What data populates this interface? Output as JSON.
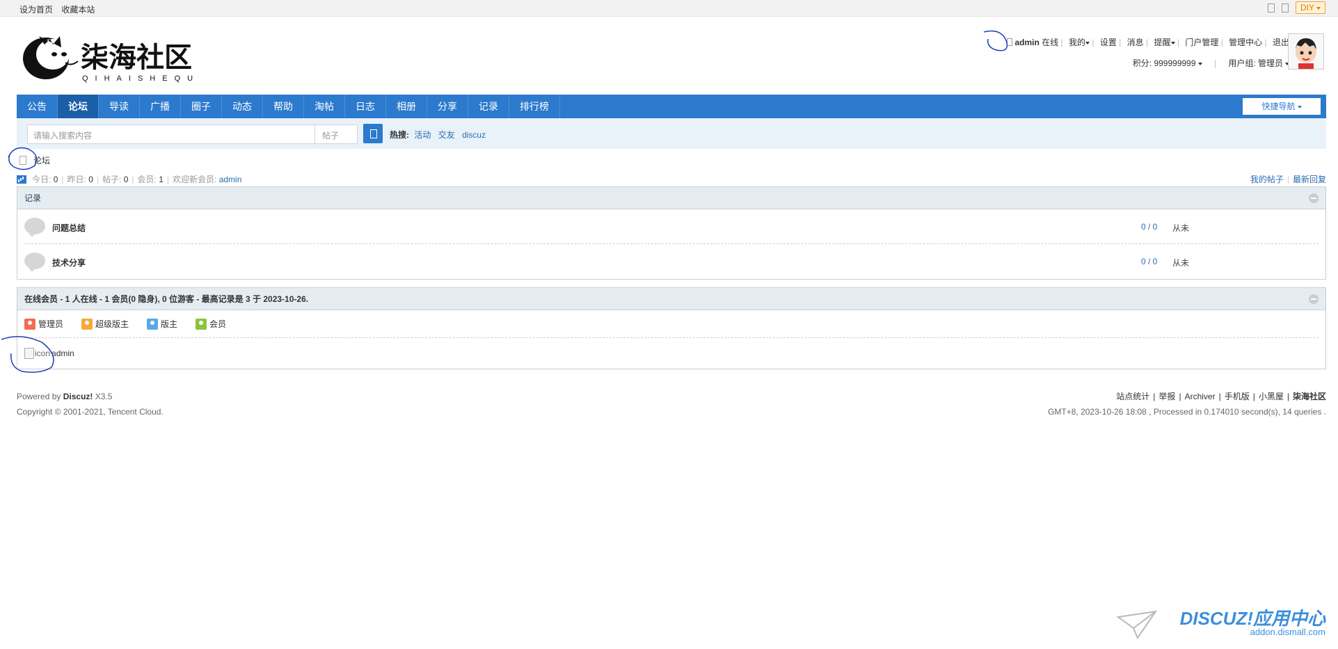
{
  "topbar": {
    "set_home": "设为首页",
    "bookmark": "收藏本站",
    "diy": "DIY"
  },
  "logo": {
    "name": "柒海社区",
    "sub": "QIHAISHEQU"
  },
  "user": {
    "name": "admin",
    "status": "在线",
    "menu": [
      "我的",
      "设置",
      "消息",
      "提醒",
      "门户管理",
      "管理中心",
      "退出"
    ],
    "credits_label": "积分: 999999999",
    "group_label": "用户组: 管理员"
  },
  "nav": {
    "items": [
      "公告",
      "论坛",
      "导读",
      "广播",
      "圈子",
      "动态",
      "帮助",
      "淘帖",
      "日志",
      "相册",
      "分享",
      "记录",
      "排行榜"
    ],
    "active": "论坛",
    "quick_nav": "快捷导航"
  },
  "search": {
    "placeholder": "请输入搜索内容",
    "type": "帖子",
    "hot_label": "热搜:",
    "hot_terms": [
      "活动",
      "交友",
      "discuz"
    ]
  },
  "breadcrumb": {
    "current": "论坛"
  },
  "stats": {
    "today_label": "今日:",
    "today": "0",
    "yesterday_label": "昨日:",
    "yesterday": "0",
    "posts_label": "帖子:",
    "posts": "0",
    "members_label": "会员:",
    "members": "1",
    "welcome_label": "欢迎新会员:",
    "newest": "admin",
    "my_posts": "我的帖子",
    "latest_replies": "最新回复"
  },
  "category": {
    "title": "记录",
    "forums": [
      {
        "name": "问题总结",
        "count": "0 / 0",
        "last": "从未"
      },
      {
        "name": "技术分享",
        "count": "0 / 0",
        "last": "从未"
      }
    ]
  },
  "online": {
    "title": "在线会员 - 1 人在线 - 1 会员(0 隐身), 0 位游客 - 最高记录是 3 于 2023-10-26.",
    "legend": [
      {
        "label": "管理员",
        "color": "#f26c4f"
      },
      {
        "label": "超级版主",
        "color": "#f7a93a"
      },
      {
        "label": "版主",
        "color": "#5aa8e8"
      },
      {
        "label": "会员",
        "color": "#8ac43f"
      }
    ],
    "user_icon_alt": "icon",
    "user": "admin"
  },
  "footer": {
    "powered_prefix": "Powered by",
    "powered_name": "Discuz!",
    "version": "X3.5",
    "copyright": "Copyright © 2001-2021, Tencent Cloud.",
    "links": [
      "站点统计",
      "举报",
      "Archiver",
      "手机版",
      "小黑屋",
      "柒海社区"
    ],
    "time_info": "GMT+8, 2023-10-26 18:08 , Processed in 0.174010 second(s), 14 queries ."
  },
  "watermark": {
    "brand": "DISCUZ!应用中心",
    "url": "addon.dismall.com"
  },
  "colors": {
    "nav": "#2b7acd",
    "nav_active": "#1a5fa8",
    "link": "#2b6cb0",
    "box_head": "#e5edf2"
  }
}
